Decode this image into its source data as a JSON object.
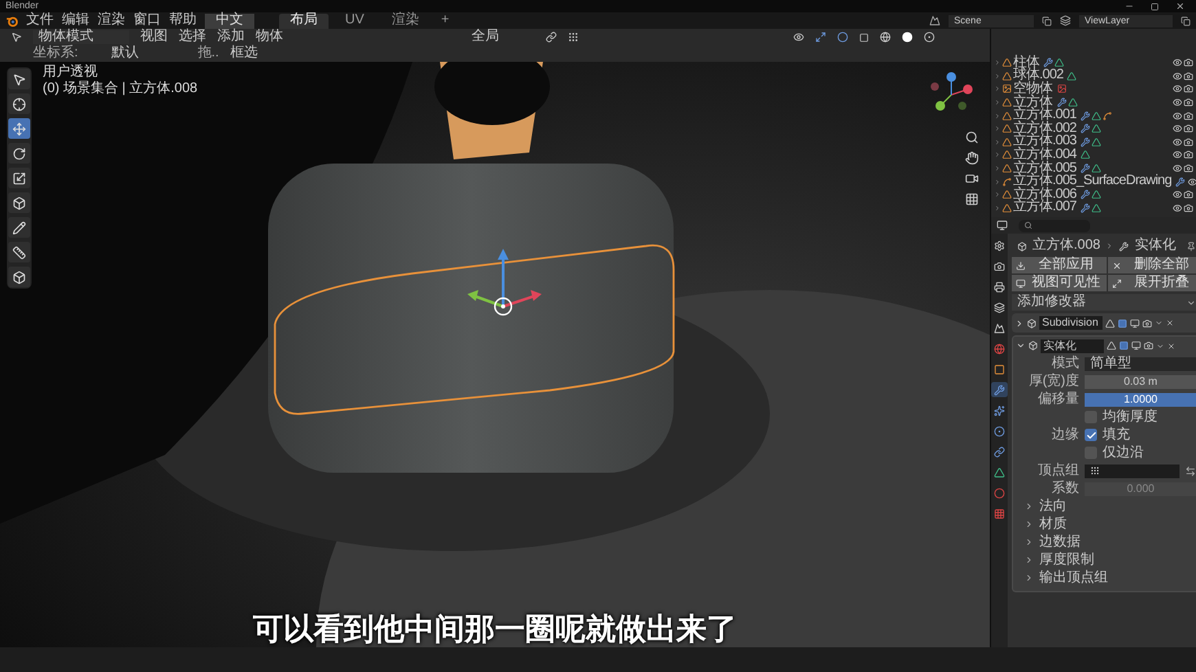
{
  "window": {
    "title": "Blender"
  },
  "menu": [
    "文件",
    "编辑",
    "渲染",
    "窗口",
    "帮助"
  ],
  "language_button": "中文",
  "workspace_tabs": [
    {
      "label": "布局",
      "selected": true
    },
    {
      "label": "UV",
      "selected": false
    },
    {
      "label": "渲染",
      "selected": false
    }
  ],
  "add_tab": "+",
  "scene": "Scene",
  "view_layer": "ViewLayer",
  "viewport_header": {
    "mode": "物体模式",
    "menus": [
      "视图",
      "选择",
      "添加",
      "物体"
    ],
    "orientation": "全局"
  },
  "tool_settings": {
    "orientation_label": "坐标系:",
    "orientation": "默认",
    "drag_label": "拖..",
    "drag": "框选"
  },
  "toolbar": [
    {
      "kind": "select",
      "selected": false
    },
    {
      "kind": "cursor",
      "selected": false
    },
    {
      "kind": "move",
      "selected": true
    },
    {
      "kind": "rotate",
      "selected": false
    },
    {
      "kind": "scale",
      "selected": false
    },
    {
      "kind": "transform",
      "selected": false
    },
    {
      "kind": "annotate",
      "selected": false
    },
    {
      "kind": "measure",
      "selected": false
    },
    {
      "kind": "add_cube",
      "selected": false
    }
  ],
  "viewport": {
    "view_name": "用户透视",
    "context": "(0) 场景集合 | 立方体.008"
  },
  "subtitle": "可以看到他中间那一圈呢就做出来了",
  "outliner": {
    "items": [
      {
        "name": "柱体",
        "kind": "mesh",
        "icons": [
          {
            "kind": "modifier"
          },
          {
            "kind": "mesh_data"
          }
        ]
      },
      {
        "name": "球体.002",
        "kind": "mesh",
        "icons": [
          {
            "kind": "mesh_data"
          }
        ]
      },
      {
        "name": "空物体",
        "kind": "empty",
        "icons": [
          {
            "kind": "image"
          }
        ]
      },
      {
        "name": "立方体",
        "kind": "mesh",
        "icons": [
          {
            "kind": "modifier"
          },
          {
            "kind": "mesh_data"
          }
        ]
      },
      {
        "name": "立方体.001",
        "kind": "mesh",
        "icons": [
          {
            "kind": "modifier"
          },
          {
            "kind": "mesh_data"
          },
          {
            "kind": "curve"
          }
        ]
      },
      {
        "name": "立方体.002",
        "kind": "mesh",
        "icons": [
          {
            "kind": "modifier"
          },
          {
            "kind": "mesh_data"
          }
        ]
      },
      {
        "name": "立方体.003",
        "kind": "mesh",
        "icons": [
          {
            "kind": "modifier"
          },
          {
            "kind": "mesh_data"
          }
        ]
      },
      {
        "name": "立方体.004",
        "kind": "mesh",
        "icons": [
          {
            "kind": "mesh_data"
          }
        ]
      },
      {
        "name": "立方体.005",
        "kind": "mesh",
        "icons": [
          {
            "kind": "modifier"
          },
          {
            "kind": "mesh_data"
          }
        ]
      },
      {
        "name": "立方体.005_SurfaceDrawing",
        "kind": "curve",
        "icons": [
          {
            "kind": "modifier"
          }
        ]
      },
      {
        "name": "立方体.006",
        "kind": "mesh",
        "icons": [
          {
            "kind": "modifier"
          },
          {
            "kind": "mesh_data"
          }
        ]
      },
      {
        "name": "立方体.007",
        "kind": "mesh",
        "icons": [
          {
            "kind": "modifier"
          },
          {
            "kind": "mesh_data"
          }
        ]
      }
    ]
  },
  "properties": {
    "tabs": [
      {
        "kind": "tool",
        "selected": false
      },
      {
        "kind": "render",
        "selected": false
      },
      {
        "kind": "output",
        "selected": false
      },
      {
        "kind": "view_layer",
        "selected": false
      },
      {
        "kind": "scene",
        "selected": false
      },
      {
        "kind": "world",
        "selected": false
      },
      {
        "kind": "object",
        "selected": false
      },
      {
        "kind": "modifier",
        "selected": true
      },
      {
        "kind": "particles",
        "selected": false
      },
      {
        "kind": "physics",
        "selected": false
      },
      {
        "kind": "constraints",
        "selected": false
      },
      {
        "kind": "data",
        "selected": false
      },
      {
        "kind": "material",
        "selected": false
      },
      {
        "kind": "texture",
        "selected": false
      }
    ],
    "breadcrumb": [
      "立方体.008",
      "实体化"
    ],
    "actions": [
      {
        "kind": "apply",
        "label": "全部应用"
      },
      {
        "kind": "delete",
        "label": "删除全部"
      },
      {
        "kind": "visibility",
        "label": "视图可见性"
      },
      {
        "kind": "expand",
        "label": "展开折叠"
      }
    ],
    "add_modifier": "添加修改器",
    "modifiers": [
      {
        "name": "Subdivision",
        "expanded": false
      },
      {
        "name": "实体化",
        "expanded": true
      }
    ],
    "solidify": {
      "mode_label": "模式",
      "mode": "简单型",
      "thickness_label": "厚(宽)度",
      "thickness": "0.03 m",
      "offset_label": "偏移量",
      "offset": {
        "value": "1.0000",
        "level": 1
      },
      "even_thickness": {
        "label": "均衡厚度",
        "checked": false
      },
      "rim_label": "边缘",
      "fill": {
        "label": "填充",
        "checked": true
      },
      "rim_only": {
        "label": "仅边沿",
        "checked": false
      },
      "vertex_group_label": "顶点组",
      "factor_label": "系数",
      "factor": "0.000"
    },
    "subpanels": [
      "法向",
      "材质",
      "边数据",
      "厚度限制",
      "输出顶点组"
    ]
  }
}
